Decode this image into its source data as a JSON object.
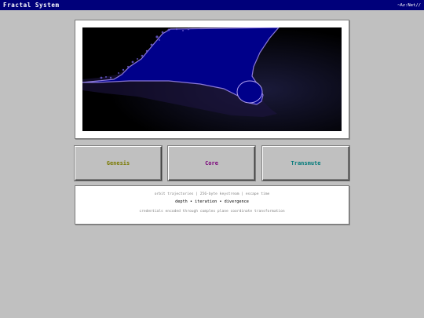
{
  "titlebar": {
    "title": "Fractal System",
    "right_text": "~Az:Net//"
  },
  "viewer": {
    "icon": "mandelbrot-fractal-render",
    "colors": {
      "interior": "#00008a",
      "edge": "#8a78d8",
      "background": "#000000"
    }
  },
  "buttons": {
    "genesis": {
      "label": "Genesis",
      "color": "#7a7a00"
    },
    "core": {
      "label": "Core",
      "color": "#7a007a"
    },
    "transmute": {
      "label": "Transmute",
      "color": "#007a7a"
    }
  },
  "info": {
    "line1": "orbit trajectories | 256-byte keystream | escape time",
    "line2": "depth • iteration • divergence",
    "line3": "credentials encoded through complex plane coordinate transformation"
  }
}
